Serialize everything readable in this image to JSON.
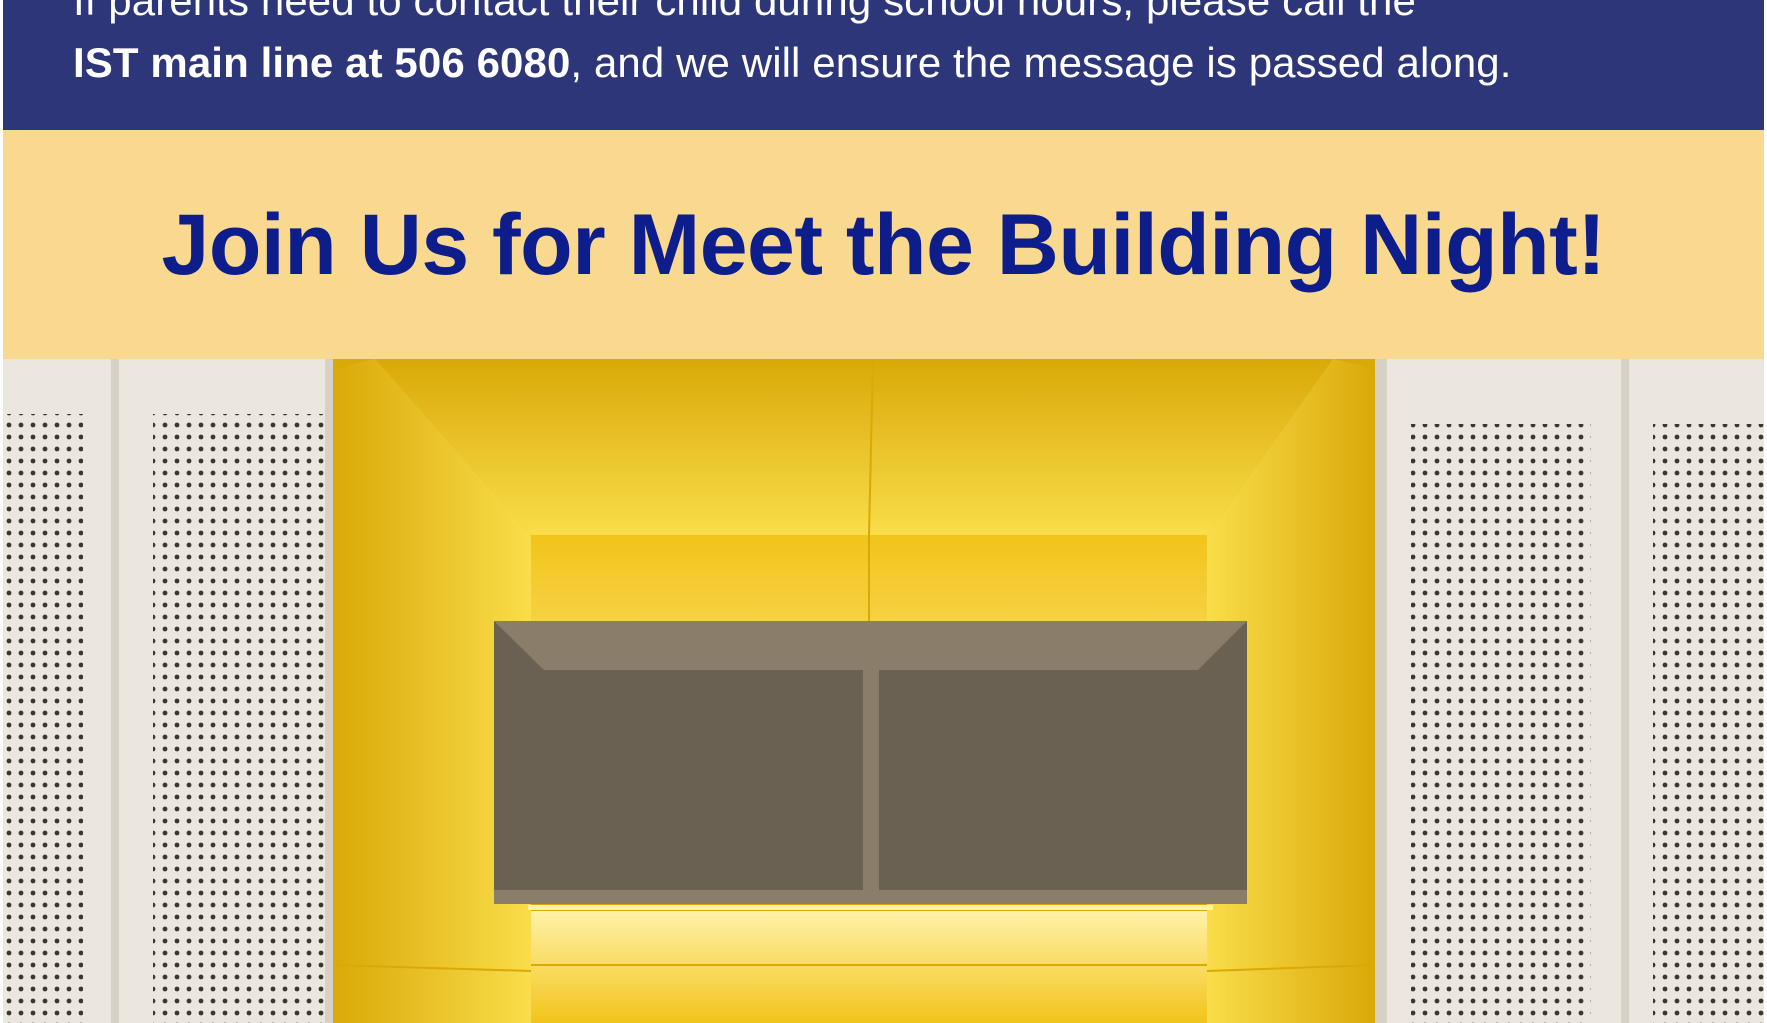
{
  "notice": {
    "line1": "If parents need to contact their child during school hours, please call the",
    "line2_bold": "IST main line at 506 6080",
    "line2_rest": ", and we will ensure the message is passed along."
  },
  "banner": {
    "heading": "Join Us for Meet the Building Night!"
  },
  "photo": {
    "subject": "yellow-upholstered-booth-with-shelf",
    "colors": {
      "upholstery": "#f2c41a",
      "upholstery_light": "#f9dd4a",
      "upholstery_shade": "#d9a908",
      "panel": "#ebe6de",
      "panel_edge": "#d6d0c6",
      "perforation": "#3a3632",
      "shelf_wood": "#8a7d6a",
      "shelf_inner": "#6b6153",
      "glow": "#fff2a8"
    }
  }
}
